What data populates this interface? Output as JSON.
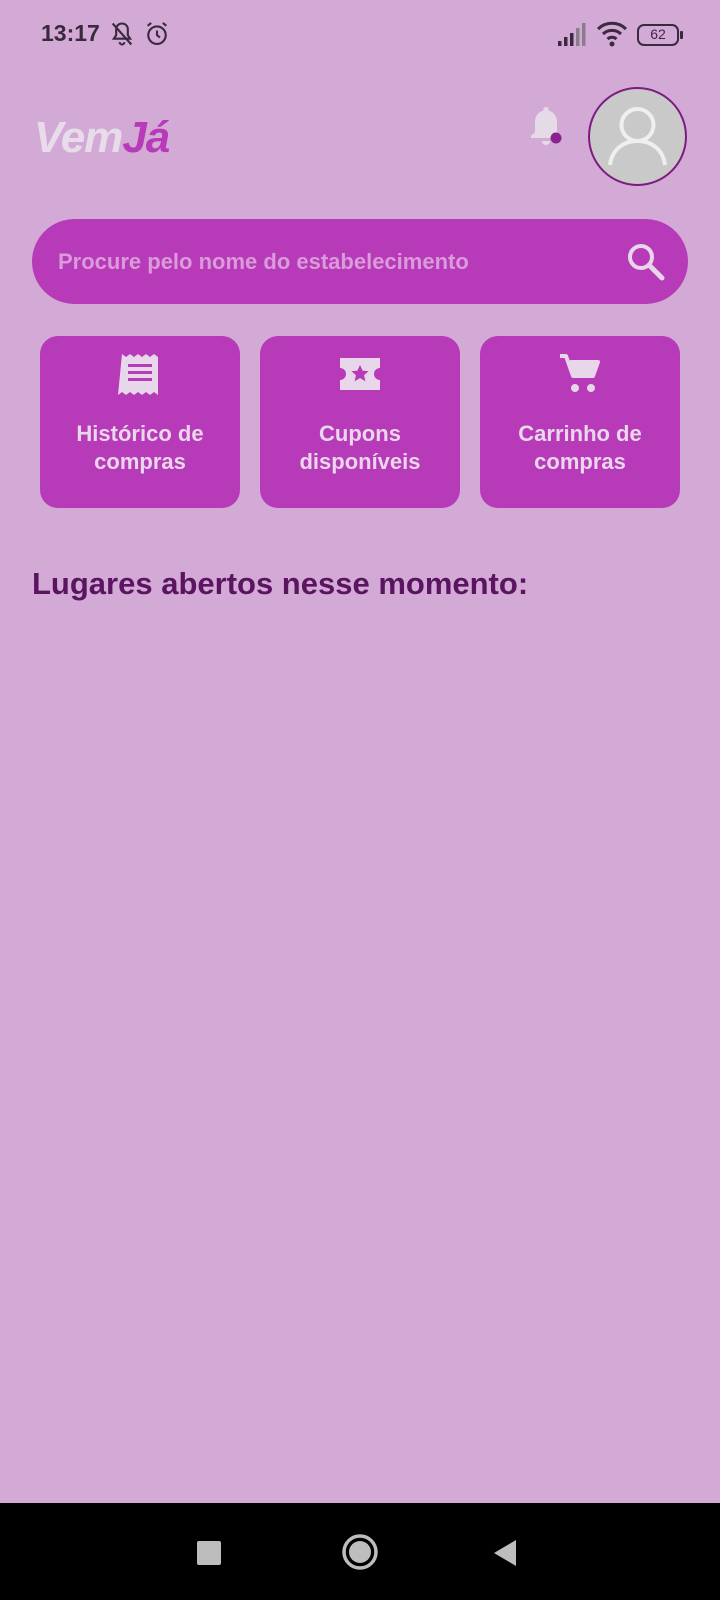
{
  "status_bar": {
    "time": "13:17",
    "icons": [
      "notifications-muted-icon",
      "alarm-icon",
      "signal-icon",
      "wifi-icon"
    ],
    "battery": "62"
  },
  "header": {
    "logo_part1": "Vem",
    "logo_part2": "Já",
    "notification_icon": "bell-icon",
    "avatar_icon": "user-avatar-icon"
  },
  "search": {
    "placeholder": "Procure pelo nome do estabelecimento",
    "icon": "search-icon"
  },
  "tiles": [
    {
      "label": "Histórico de\ncompras",
      "icon": "receipt-icon"
    },
    {
      "label": "Cupons\ndisponíveis",
      "icon": "coupon-star-icon"
    },
    {
      "label": "Carrinho de\ncompras",
      "icon": "shopping-cart-icon"
    }
  ],
  "section_title": "Lugares abertos nesse momento:",
  "navbar": {
    "buttons": [
      "recent-apps-icon",
      "home-icon",
      "back-icon"
    ]
  },
  "colors": {
    "background": "#d3aad6",
    "accent": "#b73ab8",
    "title_text": "#5a1460"
  }
}
